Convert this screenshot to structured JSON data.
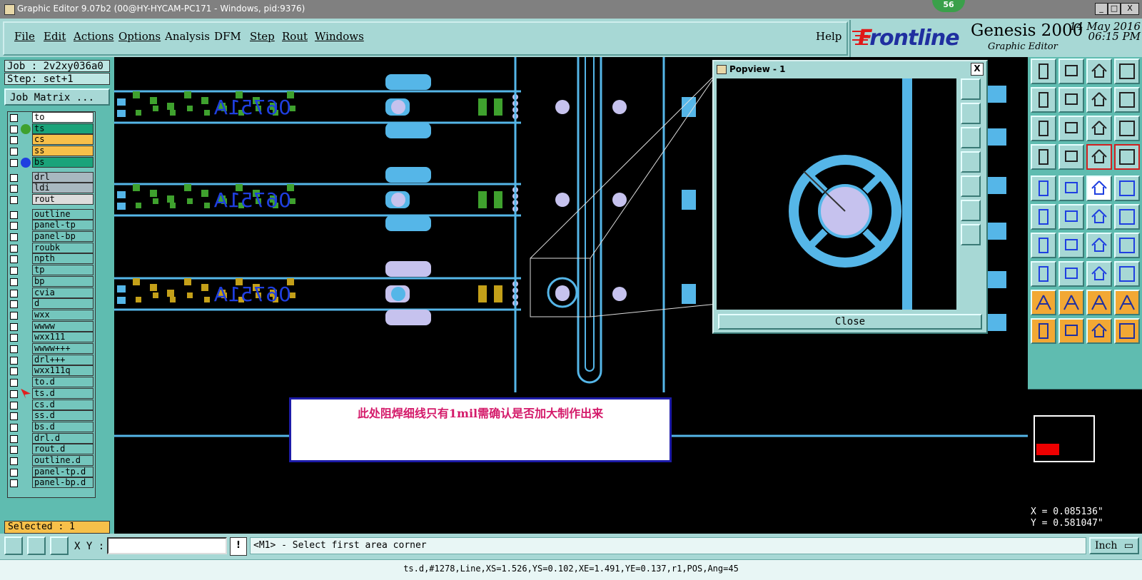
{
  "window": {
    "title": "Graphic Editor 9.07b2 (00@HY-HYCAM-PC171 - Windows, pid:9376)",
    "badge": "56",
    "minimize": "_",
    "maximize": "□",
    "close": "X"
  },
  "menu": {
    "items": [
      "File",
      "Edit",
      "Actions",
      "Options",
      "Analysis",
      "DFM",
      "Step",
      "Rout",
      "Windows"
    ],
    "help": "Help"
  },
  "brand": {
    "logo_f": "F",
    "logo_rest": "rontline",
    "product": "Genesis 2000",
    "subtitle": "Graphic Editor",
    "date": "14 May 2016",
    "time": "06:15 PM"
  },
  "job": {
    "job": "Job : 2v2xy036a0",
    "step": "Step: set+1",
    "matrix_button": "Job Matrix ..."
  },
  "layers": [
    {
      "name": "to",
      "color": "#ffffff",
      "mark": ""
    },
    {
      "name": "ts",
      "color": "#1aa37a",
      "mark": "green-dot"
    },
    {
      "name": "cs",
      "color": "#f7c04a",
      "mark": ""
    },
    {
      "name": "ss",
      "color": "#f7c04a",
      "mark": ""
    },
    {
      "name": "bs",
      "color": "#1aa37a",
      "mark": "blue-dot"
    },
    {
      "name": "drl",
      "color": "#a8b8c0",
      "mark": ""
    },
    {
      "name": "ldi",
      "color": "#a8b8c0",
      "mark": ""
    },
    {
      "name": "rout",
      "color": "#dcdcdc",
      "mark": ""
    },
    {
      "name": "outline",
      "color": "#74c6bd",
      "mark": ""
    },
    {
      "name": "panel-tp",
      "color": "#74c6bd",
      "mark": ""
    },
    {
      "name": "panel-bp",
      "color": "#74c6bd",
      "mark": ""
    },
    {
      "name": "roubk",
      "color": "#74c6bd",
      "mark": ""
    },
    {
      "name": "npth",
      "color": "#74c6bd",
      "mark": ""
    },
    {
      "name": "tp",
      "color": "#74c6bd",
      "mark": ""
    },
    {
      "name": "bp",
      "color": "#74c6bd",
      "mark": ""
    },
    {
      "name": "cvia",
      "color": "#74c6bd",
      "mark": ""
    },
    {
      "name": "d",
      "color": "#74c6bd",
      "mark": ""
    },
    {
      "name": "wxx",
      "color": "#74c6bd",
      "mark": ""
    },
    {
      "name": "wwww",
      "color": "#74c6bd",
      "mark": ""
    },
    {
      "name": "wxx111",
      "color": "#74c6bd",
      "mark": ""
    },
    {
      "name": "wwww+++",
      "color": "#74c6bd",
      "mark": ""
    },
    {
      "name": "drl+++",
      "color": "#74c6bd",
      "mark": ""
    },
    {
      "name": "wxx111q",
      "color": "#74c6bd",
      "mark": ""
    },
    {
      "name": "to.d",
      "color": "#74c6bd",
      "mark": ""
    },
    {
      "name": "ts.d",
      "color": "#74c6bd",
      "mark": "edit-arrow"
    },
    {
      "name": "cs.d",
      "color": "#74c6bd",
      "mark": ""
    },
    {
      "name": "ss.d",
      "color": "#74c6bd",
      "mark": ""
    },
    {
      "name": "bs.d",
      "color": "#74c6bd",
      "mark": ""
    },
    {
      "name": "drl.d",
      "color": "#74c6bd",
      "mark": ""
    },
    {
      "name": "rout.d",
      "color": "#74c6bd",
      "mark": ""
    },
    {
      "name": "outline.d",
      "color": "#74c6bd",
      "mark": ""
    },
    {
      "name": "panel-tp.d",
      "color": "#74c6bd",
      "mark": ""
    },
    {
      "name": "panel-bp.d",
      "color": "#74c6bd",
      "mark": ""
    }
  ],
  "selected": "Selected : 1",
  "popview": {
    "title": "Popview - 1",
    "close_x": "X",
    "close_button": "Close"
  },
  "note": {
    "text": "此处阻焊细线只有1mil需确认是否加大制作出来"
  },
  "board": {
    "text": "06751A"
  },
  "coords": {
    "x": "X = 0.085136\"",
    "y": "Y = 0.581047\""
  },
  "command": {
    "xy_label": "X Y :",
    "xy_value": "",
    "bang": "!",
    "prompt": "<M1> - Select first area corner",
    "unit": "Inch"
  },
  "status": "ts.d,#1278,Line,XS=1.526,YS=0.102,XE=1.491,YE=0.137,r1,POS,Ang=45",
  "colors": {
    "cyan_feature": "#55b6e8",
    "green_pad": "#3fa12e",
    "gold_pad": "#c4a019",
    "lavender": "#c6c2ee",
    "panel_bg": "#a7d8d5"
  }
}
